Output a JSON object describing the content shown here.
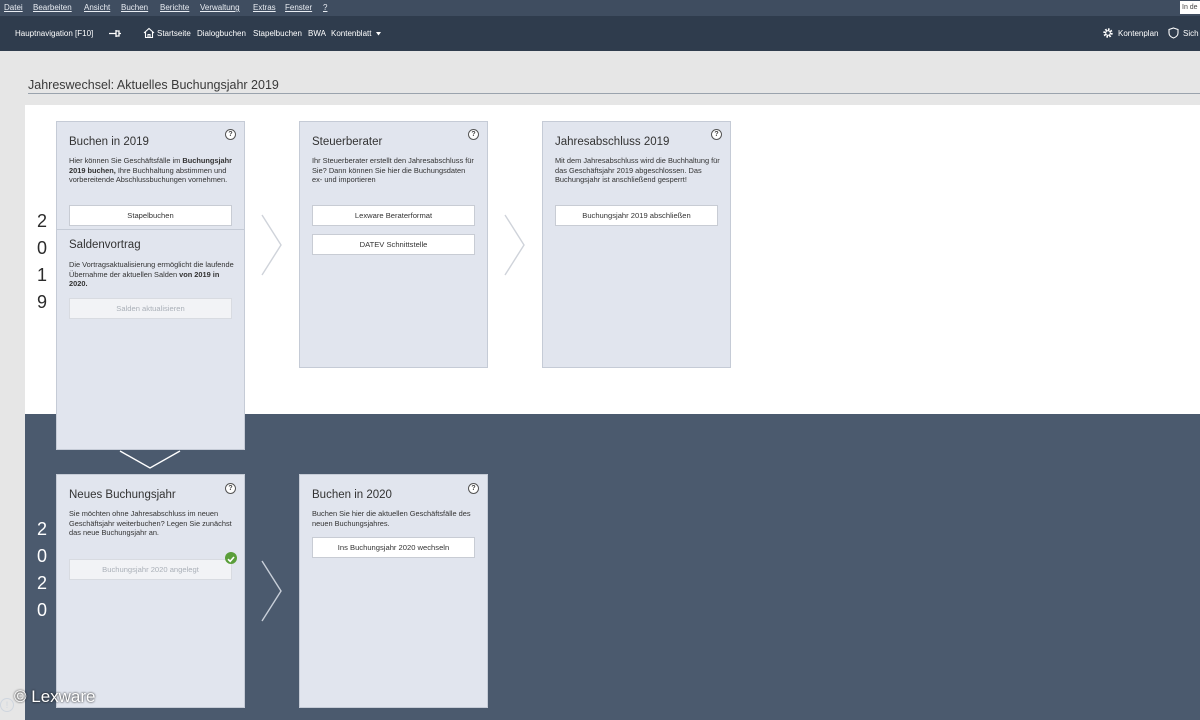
{
  "menu": {
    "items": [
      "Datei",
      "Bearbeiten",
      "Ansicht",
      "Buchen",
      "Berichte",
      "Verwaltung",
      "Extras",
      "Fenster",
      "?"
    ],
    "search_text": "In de"
  },
  "toolbar": {
    "main_nav": "Hauptnavigation [F10]",
    "home": "Startseite",
    "dialogbuchen": "Dialogbuchen",
    "stapelbuchen": "Stapelbuchen",
    "bwa": "BWA",
    "kontenblatt": "Kontenblatt",
    "kontenplan": "Kontenplan",
    "right_cut": "Sich"
  },
  "page": {
    "title": "Jahreswechsel: Aktuelles Buchungsjahr 2019"
  },
  "years": {
    "y2019": [
      "2",
      "0",
      "1",
      "9"
    ],
    "y2020": [
      "2",
      "0",
      "2",
      "0"
    ]
  },
  "cards": {
    "buchen2019": {
      "title": "Buchen in 2019",
      "text_pre": "Hier können Sie Geschäftsfälle im ",
      "text_bold": "Buchungsjahr 2019 buchen,",
      "text_post": " Ihre Buchhaltung abstimmen und vorbereitende Abschlussbuchungen vornehmen.",
      "button": "Stapelbuchen"
    },
    "saldenvortrag": {
      "title": "Saldenvortrag",
      "text_pre": "Die Vortragsaktualisierung ermöglicht die laufende Übernahme der aktuellen Salden ",
      "text_bold": "von 2019 in 2020.",
      "button": "Salden aktualisieren"
    },
    "steuerberater": {
      "title": "Steuerberater",
      "text": "Ihr Steuerberater erstellt den Jahresabschluss für Sie? Dann können Sie hier die Buchungsdaten ex- und importieren",
      "button1": "Lexware Beraterformat",
      "button2": "DATEV Schnittstelle"
    },
    "jahresabschluss": {
      "title": "Jahresabschluss 2019",
      "text": "Mit dem Jahresabschluss wird die Buchhaltung für das Geschäftsjahr 2019 abgeschlossen.  Das Buchungsjahr ist anschließend gesperrt!",
      "button": "Buchungsjahr 2019 abschließen"
    },
    "neues": {
      "title": "Neues Buchungsjahr",
      "text": "Sie möchten ohne Jahresabschluss im neuen Geschäftsjahr weiterbuchen?  Legen Sie zunächst das neue Buchungsjahr an.",
      "button": "Buchungsjahr 2020 angelegt"
    },
    "buchen2020": {
      "title": "Buchen in 2020",
      "text": "Buchen Sie hier die aktuellen Geschäftsfälle des neuen Buchungsjahres.",
      "button": "Ins Buchungsjahr 2020 wechseln"
    }
  },
  "help_glyph": "?",
  "footer": {
    "credit": "© Lexware",
    "info_glyph": "!"
  },
  "colors": {
    "menubar": "#3f4d60",
    "toolbar": "#2f3c4d",
    "panel_2020": "#4b5a6e",
    "card": "#e1e5ee",
    "check": "#5a9e3a"
  }
}
